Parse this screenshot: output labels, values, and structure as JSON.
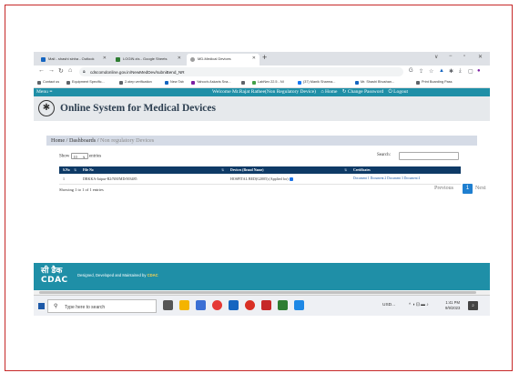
{
  "browser": {
    "tabs": [
      {
        "label": "Mail - shashi sinha - Outlook",
        "color": "#1565c0"
      },
      {
        "label": "LOGIN.xls - Google Sheets",
        "color": "#2e7d32"
      },
      {
        "label": "MD-Medical Devices",
        "color": "#9e9e9e"
      }
    ],
    "new_tab": "+",
    "window_controls": [
      "∨",
      "−",
      "▫",
      "✕"
    ],
    "url": "cdscomdonline.gov.in/NewMedDev/subniBend_NR",
    "bookmarks": [
      {
        "label": "Contact us",
        "color": "#5f6368"
      },
      {
        "label": "Equipment Specific...",
        "color": "#5f6368"
      },
      {
        "label": "2-step verification",
        "color": "#5f6368"
      },
      {
        "label": "New Tab",
        "color": "#1565c0"
      },
      {
        "label": "Yahoo's Askaris Sna...",
        "color": "#7b1fa2"
      },
      {
        "label": "",
        "color": "#5f6368"
      },
      {
        "label": "LabNex 22.5 - NI",
        "color": "#43a047"
      },
      {
        "label": "(37) Manik Sharma...",
        "color": "#1877f2"
      },
      {
        "label": "Mr. Shashi Bhushan...",
        "color": "#1565c0"
      },
      {
        "label": "Print Boarding Pass",
        "color": "#5f6368"
      }
    ]
  },
  "nav": {
    "menu": "Menu ≡",
    "welcome": "Welcome Mr.Rajat Rathee(Non Regulatory Device)",
    "home": "⌂ Home",
    "change_password": "↻ Change Password",
    "logout": "⏻ Logout"
  },
  "header": {
    "title": "Online System for Medical Devices",
    "logo_glyph": "✱"
  },
  "breadcrumb": {
    "home": "Home",
    "sep1": " / ",
    "dashboards": "Dashboards",
    "sep2": " / ",
    "current": "Non regulatory Devices"
  },
  "controls": {
    "show_label": "Show",
    "show_value": "10",
    "entries_label": "entries",
    "search_label": "Search:"
  },
  "table": {
    "columns": [
      "S.No",
      "File No",
      "Devices (Brand Name)",
      "Certificates"
    ],
    "rows": [
      {
        "sno": "1",
        "file_no": "DRKKA-Jaipur-R2/NM/MD/003485",
        "device": "HOSPITAL BED(G2005) (Applied for)",
        "certificates": "Document 1 Document 2 Document 3 Document 4"
      }
    ]
  },
  "info": "Showing 1 to 1 of 1 entries",
  "pager": {
    "previous": "Previous",
    "page": "1",
    "next": "Next"
  },
  "footer": {
    "logo_hindi": "सी डैक",
    "logo_en": "CDAC",
    "designed": "Designed, Developed and Maintained by ",
    "brand": "CDAC"
  },
  "taskbar": {
    "search_placeholder": "Type here to search",
    "tray_text": "USD...",
    "time": "1:41 PM",
    "date": "9/9/2023",
    "notif_count": "2"
  },
  "colors": {
    "accent": "#1f8fa7",
    "table_header": "#0e3a66",
    "frame": "#c62828"
  }
}
